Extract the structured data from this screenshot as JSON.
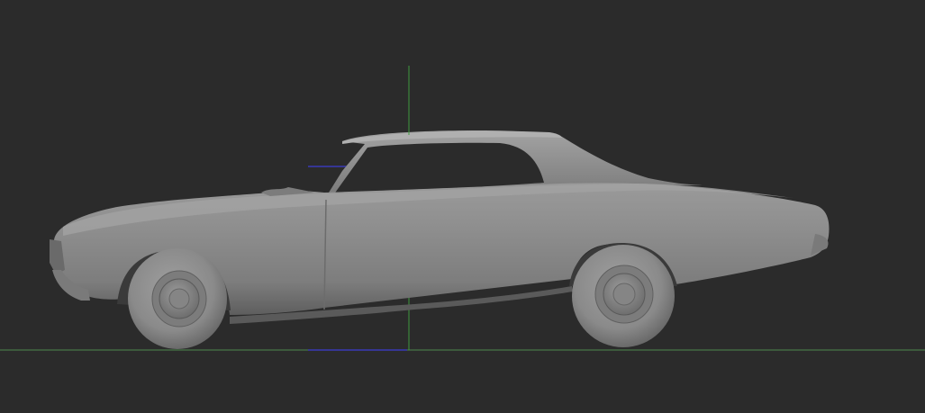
{
  "viewport": {
    "view": "side",
    "background": "#2b2b2b",
    "model_color": "#8a8a8a",
    "axis_colors": {
      "green": "#3f9a3f",
      "blue": "#3a3ab8"
    },
    "ground_line_color": "#4c8a4c"
  }
}
